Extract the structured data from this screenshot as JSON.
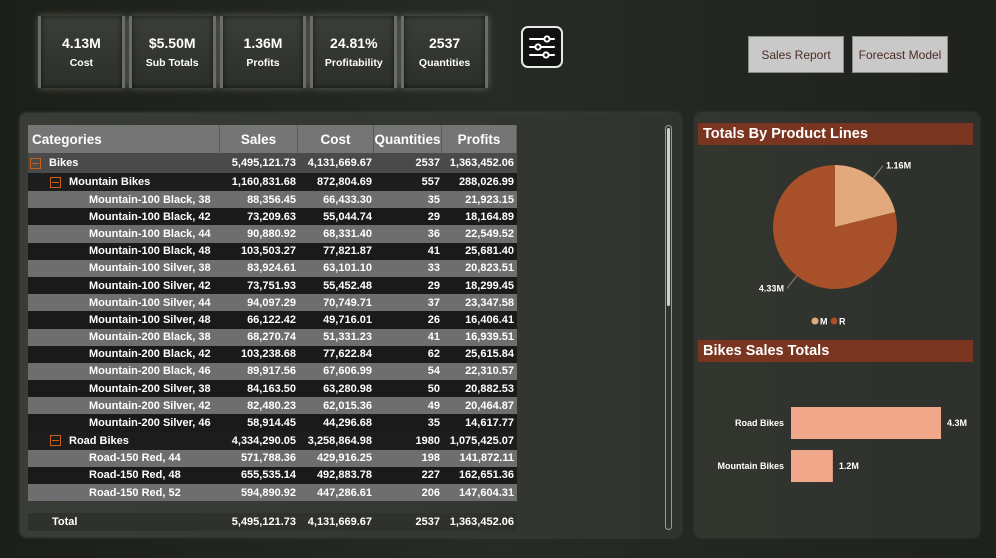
{
  "kpis": [
    {
      "value": "4.13M",
      "label": "Cost"
    },
    {
      "value": "$5.50M",
      "label": "Sub Totals"
    },
    {
      "value": "1.36M",
      "label": "Profits"
    },
    {
      "value": "24.81%",
      "label": "Profitability"
    },
    {
      "value": "2537",
      "label": "Quantities"
    }
  ],
  "nav": {
    "sales_report": "Sales Report",
    "forecast_model": "Forecast Model"
  },
  "matrix": {
    "headers": [
      "Categories",
      "Sales",
      "Cost",
      "Quantities",
      "Profits"
    ],
    "rows": [
      {
        "level": 0,
        "name": "Bikes",
        "sales": "5,495,121.73",
        "cost": "4,131,669.67",
        "qty": "2537",
        "profit": "1,363,452.06"
      },
      {
        "level": 1,
        "name": "Mountain Bikes",
        "sales": "1,160,831.68",
        "cost": "872,804.69",
        "qty": "557",
        "profit": "288,026.99"
      },
      {
        "level": 2,
        "name": "Mountain-100 Black, 38",
        "sales": "88,356.45",
        "cost": "66,433.30",
        "qty": "35",
        "profit": "21,923.15"
      },
      {
        "level": 2,
        "name": "Mountain-100 Black, 42",
        "sales": "73,209.63",
        "cost": "55,044.74",
        "qty": "29",
        "profit": "18,164.89"
      },
      {
        "level": 2,
        "name": "Mountain-100 Black, 44",
        "sales": "90,880.92",
        "cost": "68,331.40",
        "qty": "36",
        "profit": "22,549.52"
      },
      {
        "level": 2,
        "name": "Mountain-100 Black, 48",
        "sales": "103,503.27",
        "cost": "77,821.87",
        "qty": "41",
        "profit": "25,681.40"
      },
      {
        "level": 2,
        "name": "Mountain-100 Silver, 38",
        "sales": "83,924.61",
        "cost": "63,101.10",
        "qty": "33",
        "profit": "20,823.51"
      },
      {
        "level": 2,
        "name": "Mountain-100 Silver, 42",
        "sales": "73,751.93",
        "cost": "55,452.48",
        "qty": "29",
        "profit": "18,299.45"
      },
      {
        "level": 2,
        "name": "Mountain-100 Silver, 44",
        "sales": "94,097.29",
        "cost": "70,749.71",
        "qty": "37",
        "profit": "23,347.58"
      },
      {
        "level": 2,
        "name": "Mountain-100 Silver, 48",
        "sales": "66,122.42",
        "cost": "49,716.01",
        "qty": "26",
        "profit": "16,406.41"
      },
      {
        "level": 2,
        "name": "Mountain-200 Black, 38",
        "sales": "68,270.74",
        "cost": "51,331.23",
        "qty": "41",
        "profit": "16,939.51"
      },
      {
        "level": 2,
        "name": "Mountain-200 Black, 42",
        "sales": "103,238.68",
        "cost": "77,622.84",
        "qty": "62",
        "profit": "25,615.84"
      },
      {
        "level": 2,
        "name": "Mountain-200 Black, 46",
        "sales": "89,917.56",
        "cost": "67,606.99",
        "qty": "54",
        "profit": "22,310.57"
      },
      {
        "level": 2,
        "name": "Mountain-200 Silver, 38",
        "sales": "84,163.50",
        "cost": "63,280.98",
        "qty": "50",
        "profit": "20,882.53"
      },
      {
        "level": 2,
        "name": "Mountain-200 Silver, 42",
        "sales": "82,480.23",
        "cost": "62,015.36",
        "qty": "49",
        "profit": "20,464.87"
      },
      {
        "level": 2,
        "name": "Mountain-200 Silver, 46",
        "sales": "58,914.45",
        "cost": "44,296.68",
        "qty": "35",
        "profit": "14,617.77"
      },
      {
        "level": 1,
        "name": "Road Bikes",
        "sales": "4,334,290.05",
        "cost": "3,258,864.98",
        "qty": "1980",
        "profit": "1,075,425.07"
      },
      {
        "level": 2,
        "name": "Road-150 Red, 44",
        "sales": "571,788.36",
        "cost": "429,916.25",
        "qty": "198",
        "profit": "141,872.11"
      },
      {
        "level": 2,
        "name": "Road-150 Red, 48",
        "sales": "655,535.14",
        "cost": "492,883.78",
        "qty": "227",
        "profit": "162,651.36"
      },
      {
        "level": 2,
        "name": "Road-150 Red, 52",
        "sales": "594,890.92",
        "cost": "447,286.61",
        "qty": "206",
        "profit": "147,604.31"
      }
    ],
    "total": {
      "name": "Total",
      "sales": "5,495,121.73",
      "cost": "4,131,669.67",
      "qty": "2537",
      "profit": "1,363,452.06"
    }
  },
  "product_lines": {
    "title": "Totals By Product Lines",
    "legend": [
      "M",
      "R"
    ],
    "colors": {
      "M": "#e2a97d",
      "R": "#a8502a"
    }
  },
  "bikes_sales": {
    "title": "Bikes Sales Totals",
    "bar_color": "#f0a78a"
  },
  "chart_data": [
    {
      "type": "pie",
      "title": "Totals By Product Lines",
      "categories": [
        "M",
        "R"
      ],
      "values": [
        1.16,
        4.33
      ],
      "labels": [
        "1.16M",
        "4.33M"
      ],
      "legend": "bottom"
    },
    {
      "type": "bar",
      "orientation": "horizontal",
      "title": "Bikes Sales Totals",
      "categories": [
        "Road Bikes",
        "Mountain Bikes"
      ],
      "values": [
        4.3,
        1.2
      ],
      "labels": [
        "4.3M",
        "1.2M"
      ]
    }
  ]
}
